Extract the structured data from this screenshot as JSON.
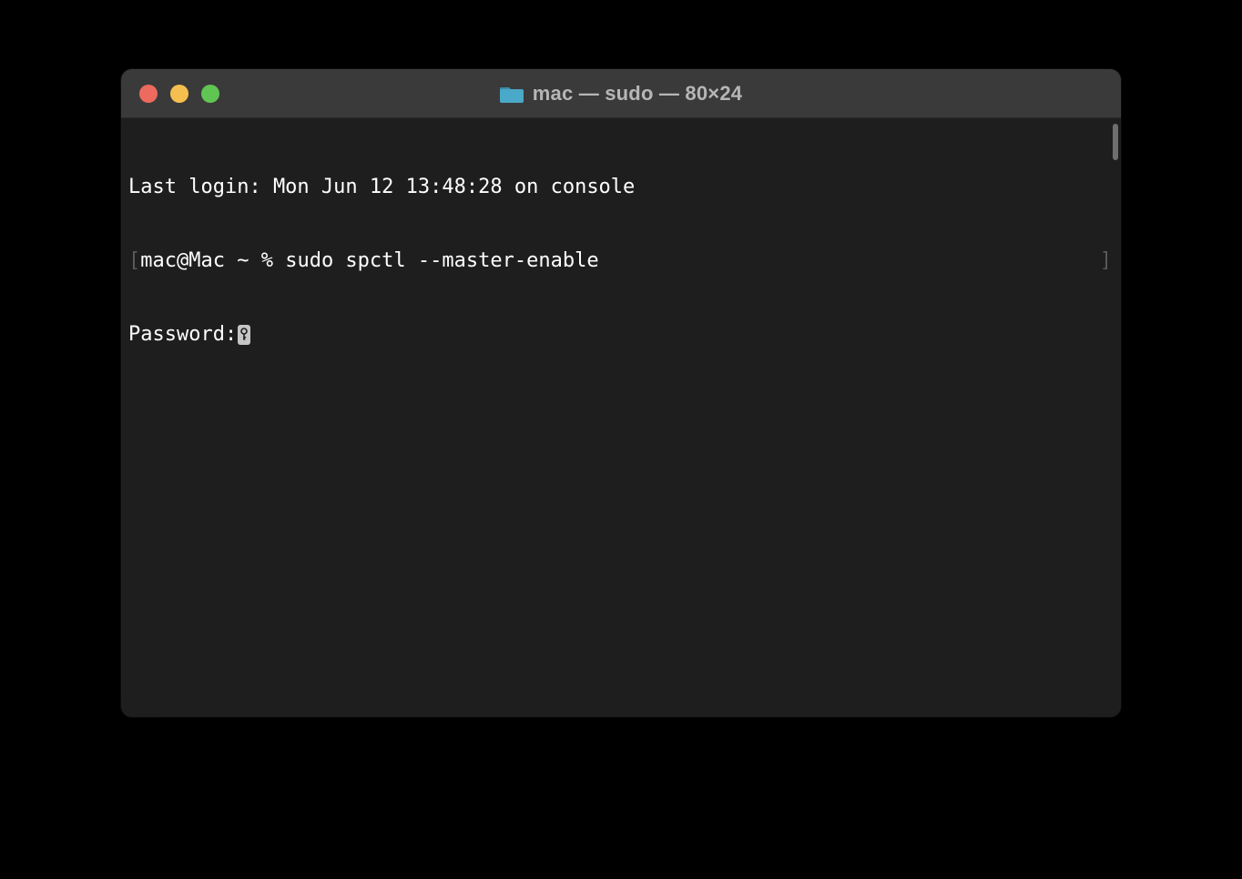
{
  "window": {
    "title": "mac — sudo — 80×24",
    "folder_icon": "folder-icon"
  },
  "terminal": {
    "line1": "Last login: Mon Jun 12 13:48:28 on console",
    "line2_open": "[",
    "line2_prompt": "mac@Mac ~ % ",
    "line2_command": "sudo spctl --master-enable",
    "line2_close": "]",
    "line3_label": "Password:",
    "key_icon": "key-icon"
  },
  "colors": {
    "window_bg": "#1e1e1e",
    "titlebar_bg": "#3a3a3a",
    "text": "#ffffff",
    "title_text": "#b6b6b6",
    "close": "#ec6a5e",
    "minimize": "#f5bf4f",
    "zoom": "#61c554"
  }
}
